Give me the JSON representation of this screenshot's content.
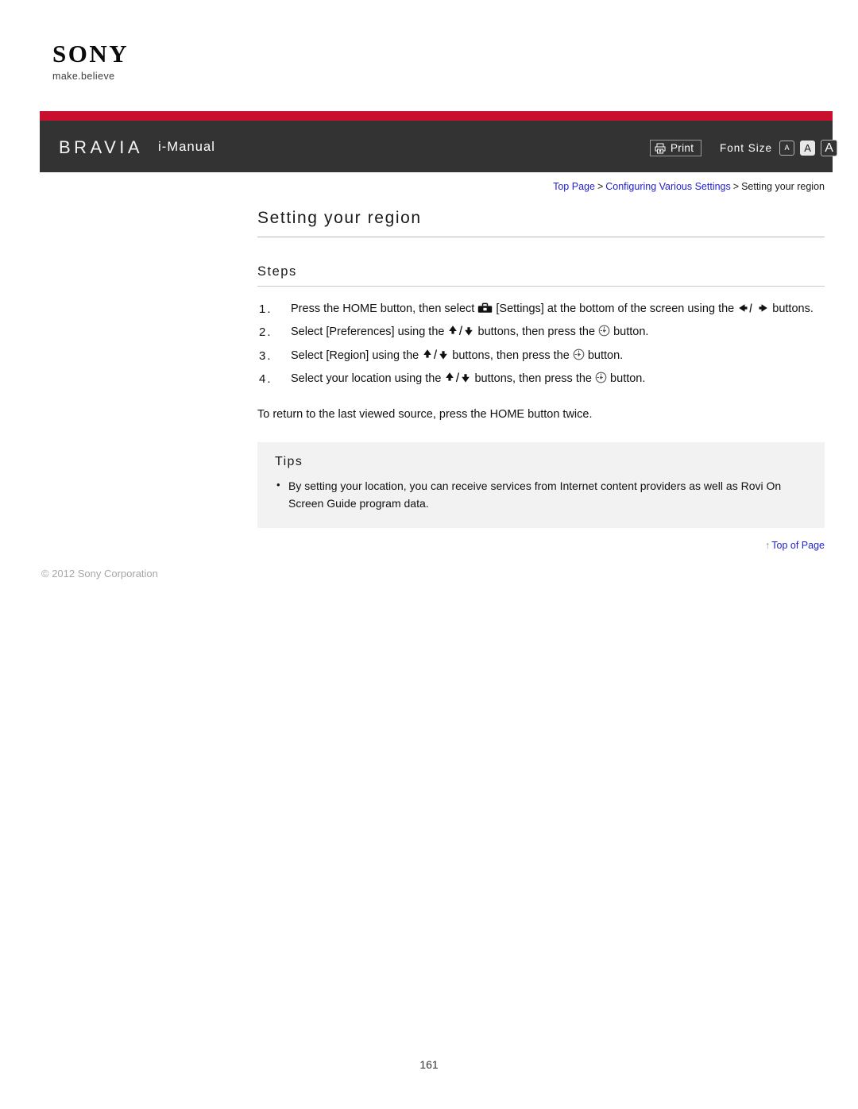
{
  "brand": {
    "wordmark": "SONY",
    "tagline": "make.believe"
  },
  "header": {
    "product_logo": "BRAVIA",
    "manual_title": "i-Manual",
    "print_label": "Print",
    "print_icon": "printer-icon",
    "font_size_label": "Font Size",
    "font_size_options": [
      {
        "label": "A",
        "size": "small",
        "selected": false
      },
      {
        "label": "A",
        "size": "medium",
        "selected": true
      },
      {
        "label": "A",
        "size": "large",
        "selected": false
      }
    ],
    "colors": {
      "red_band": "#c8102e",
      "bar": "#333333",
      "link": "#2222cc"
    }
  },
  "breadcrumb": {
    "items": [
      {
        "label": "Top Page",
        "link": true
      },
      {
        "label": "Configuring Various Settings",
        "link": true
      },
      {
        "label": "Setting your region",
        "link": false
      }
    ],
    "separator": ">"
  },
  "main": {
    "page_title": "Setting your region",
    "steps_heading": "Steps",
    "steps": [
      {
        "number": "1.",
        "parts": [
          {
            "type": "text",
            "value": "Press the HOME button, then select "
          },
          {
            "type": "icon",
            "value": "settings-toolbox-icon"
          },
          {
            "type": "text",
            "value": " [Settings] at the bottom of the screen using the "
          },
          {
            "type": "icon",
            "value": "left-right-arrows-icon"
          },
          {
            "type": "text",
            "value": " buttons."
          }
        ]
      },
      {
        "number": "2.",
        "parts": [
          {
            "type": "text",
            "value": "Select [Preferences] using the "
          },
          {
            "type": "icon",
            "value": "up-down-arrows-icon"
          },
          {
            "type": "text",
            "value": " buttons, then press the "
          },
          {
            "type": "icon",
            "value": "enter-dpad-icon"
          },
          {
            "type": "text",
            "value": " button."
          }
        ]
      },
      {
        "number": "3.",
        "parts": [
          {
            "type": "text",
            "value": "Select [Region] using the "
          },
          {
            "type": "icon",
            "value": "up-down-arrows-icon"
          },
          {
            "type": "text",
            "value": " buttons, then press the "
          },
          {
            "type": "icon",
            "value": "enter-dpad-icon"
          },
          {
            "type": "text",
            "value": " button."
          }
        ]
      },
      {
        "number": "4.",
        "parts": [
          {
            "type": "text",
            "value": "Select your location using the "
          },
          {
            "type": "icon",
            "value": "up-down-arrows-icon"
          },
          {
            "type": "text",
            "value": " buttons, then press the "
          },
          {
            "type": "icon",
            "value": "enter-dpad-icon"
          },
          {
            "type": "text",
            "value": " button."
          }
        ]
      }
    ],
    "note": "To return to the last viewed source, press the HOME button twice.",
    "tips": {
      "heading": "Tips",
      "items": [
        "By setting your location, you can receive services from Internet content providers as well as Rovi On Screen Guide program data."
      ]
    }
  },
  "footer": {
    "top_of_page": "Top of Page",
    "top_of_page_arrow": "↑",
    "copyright": "© 2012 Sony Corporation",
    "page_number": "161"
  }
}
